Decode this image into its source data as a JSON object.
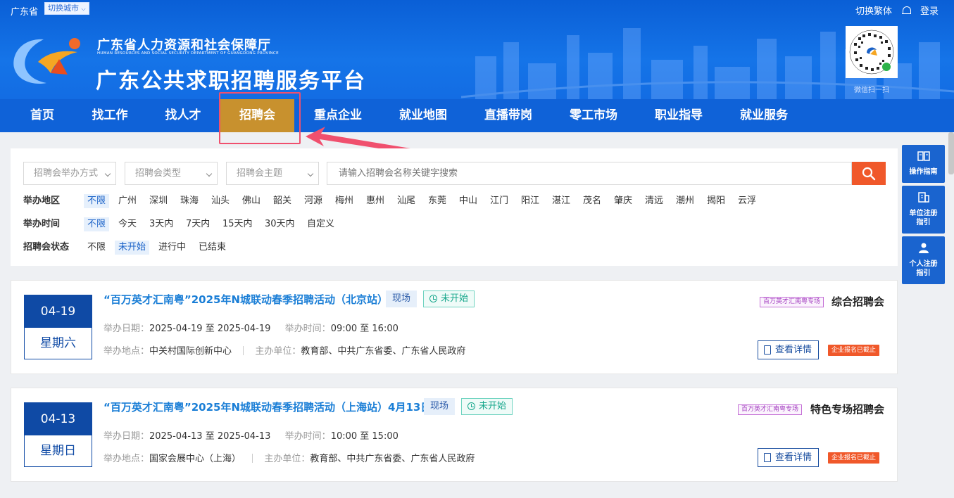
{
  "topbar": {
    "province": "广东省",
    "switch_city": "切换城市",
    "traditional": "切换繁体",
    "login": "登录"
  },
  "header": {
    "org_cn": "广东省人力资源和社会保障厅",
    "org_en": "HUMAN RESOURCES AND SOCIAL SECURITY DEPARTMENT OF GUANGDONG PROVINCE",
    "site_title": "广东公共求职招聘服务平台",
    "qr_caption": "微信扫一扫"
  },
  "nav": {
    "items": [
      "首页",
      "找工作",
      "找人才",
      "招聘会",
      "重点企业",
      "就业地图",
      "直播带岗",
      "零工市场",
      "职业指导",
      "就业服务"
    ],
    "active_index": 3
  },
  "filters": {
    "select_mode": "招聘会举办方式",
    "select_type": "招聘会类型",
    "select_theme": "招聘会主题",
    "search_placeholder": "请输入招聘会名称关键字搜索",
    "region_label": "举办地区",
    "regions": [
      "不限",
      "广州",
      "深圳",
      "珠海",
      "汕头",
      "佛山",
      "韶关",
      "河源",
      "梅州",
      "惠州",
      "汕尾",
      "东莞",
      "中山",
      "江门",
      "阳江",
      "湛江",
      "茂名",
      "肇庆",
      "清远",
      "潮州",
      "揭阳",
      "云浮"
    ],
    "time_label": "举办时间",
    "times": [
      "不限",
      "今天",
      "3天内",
      "7天内",
      "15天内",
      "30天内",
      "自定义"
    ],
    "status_label": "招聘会状态",
    "statuses": [
      "不限",
      "未开始",
      "进行中",
      "已结束"
    ]
  },
  "fairs": [
    {
      "date": "04-19",
      "weekday": "星期六",
      "title": "“百万英才汇南粤”2025年N城联动春季招聘活动（北京站）",
      "site_tag": "现场",
      "status": "未开始",
      "date_label": "举办日期：",
      "date_range": "2025-04-19 至 2025-04-19",
      "time_label": "举办时间：",
      "time_range": "09:00 至 16:00",
      "place_label": "举办地点：",
      "place": "中关村国际创新中心",
      "host_label": "主办单位：",
      "host": "教育部、中共广东省委、广东省人民政府",
      "special_badge": "百万英才汇南粤专场",
      "fair_type": "综合招聘会",
      "detail_button": "查看详情",
      "closed_badge": "企业报名已截止"
    },
    {
      "date": "04-13",
      "weekday": "星期日",
      "title": "“百万英才汇南粤”2025年N城联动春季招聘活动（上海站）4月13日",
      "site_tag": "现场",
      "status": "未开始",
      "date_label": "举办日期：",
      "date_range": "2025-04-13 至 2025-04-13",
      "time_label": "举办时间：",
      "time_range": "10:00 至 15:00",
      "place_label": "举办地点：",
      "place": "国家会展中心（上海）",
      "host_label": "主办单位：",
      "host": "教育部、中共广东省委、广东省人民政府",
      "special_badge": "百万英才汇南粤专场",
      "fair_type": "特色专场招聘会",
      "detail_button": "查看详情",
      "closed_badge": "企业报名已截止"
    }
  ],
  "side": {
    "guide": "操作指南",
    "unit_reg_1": "单位注册",
    "unit_reg_2": "指引",
    "person_reg_1": "个人注册",
    "person_reg_2": "指引"
  },
  "colors": {
    "nav_bg": "#0f62d8",
    "nav_active": "#c8912e",
    "accent_orange": "#f0582a",
    "title_blue": "#1a7ed6"
  }
}
